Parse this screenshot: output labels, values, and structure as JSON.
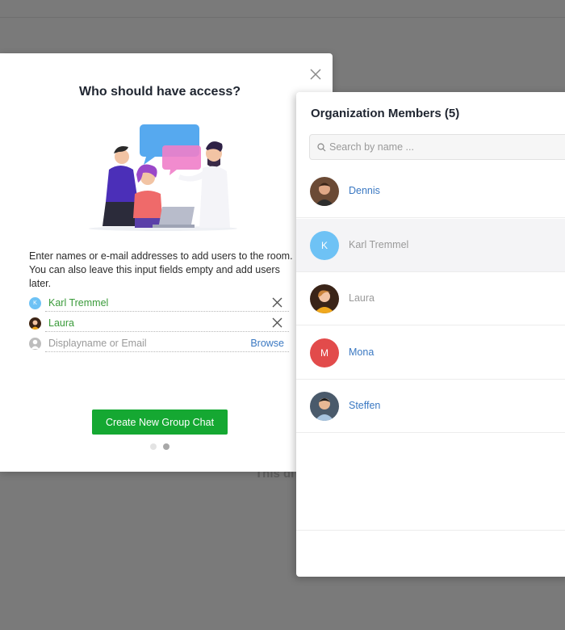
{
  "background": {
    "partial_text": "This di"
  },
  "dialog": {
    "title": "Who should have access?",
    "help_line1": "Enter names or e-mail addresses to add users to the room.",
    "help_line2": "You can also leave this input fields empty and add users later.",
    "recipients": [
      {
        "name": "Karl Tremmel",
        "initial": "K",
        "color": "#6ec2f5"
      },
      {
        "name": "Laura",
        "initial": "",
        "color": "#c98a3c"
      }
    ],
    "input_placeholder": "Displayname or Email",
    "browse_label": "Browse",
    "create_button": "Create New Group Chat",
    "accent_color": "#15a832"
  },
  "panel": {
    "title": "Organization Members (5)",
    "search_placeholder": "Search by name ...",
    "members": [
      {
        "name": "Dennis",
        "initial": "",
        "state": "active",
        "color": "#7a5038"
      },
      {
        "name": "Karl Tremmel",
        "initial": "K",
        "state": "selected",
        "color": "#6ec2f5"
      },
      {
        "name": "Laura",
        "initial": "",
        "state": "muted",
        "color": "#c98a3c"
      },
      {
        "name": "Mona",
        "initial": "M",
        "state": "active",
        "color": "#e24b4b"
      },
      {
        "name": "Steffen",
        "initial": "",
        "state": "active",
        "color": "#3b4a5c"
      }
    ]
  }
}
